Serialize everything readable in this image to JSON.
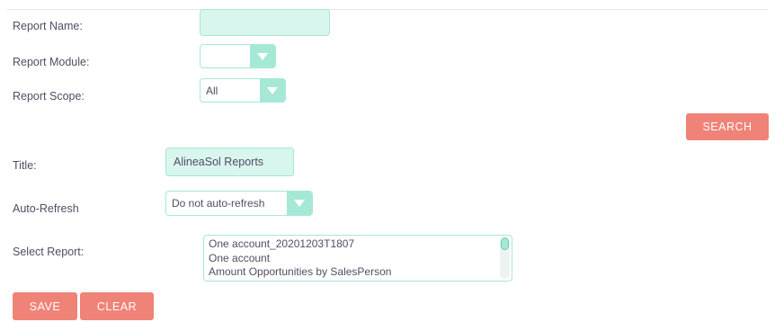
{
  "form": {
    "report_name": {
      "label": "Report Name:",
      "value": ""
    },
    "report_module": {
      "label": "Report Module:",
      "value": ""
    },
    "report_scope": {
      "label": "Report Scope:",
      "value": "All"
    },
    "search_button": "SEARCH",
    "title": {
      "label": "Title:",
      "value": "AlineaSol Reports"
    },
    "auto_refresh": {
      "label": "Auto-Refresh",
      "value": "Do not auto-refresh"
    },
    "select_report": {
      "label": "Select Report:",
      "options": [
        "One account_20201203T1807",
        "One account",
        "Amount Opportunities by SalesPerson"
      ]
    },
    "save_button": "SAVE",
    "clear_button": "CLEAR"
  },
  "colors": {
    "accent_button": "#f08377",
    "field_background": "#d8f5ee",
    "field_border": "#a5e8d6",
    "text": "#534d64"
  },
  "icons": {
    "dropdown": "chevron-down-icon"
  }
}
